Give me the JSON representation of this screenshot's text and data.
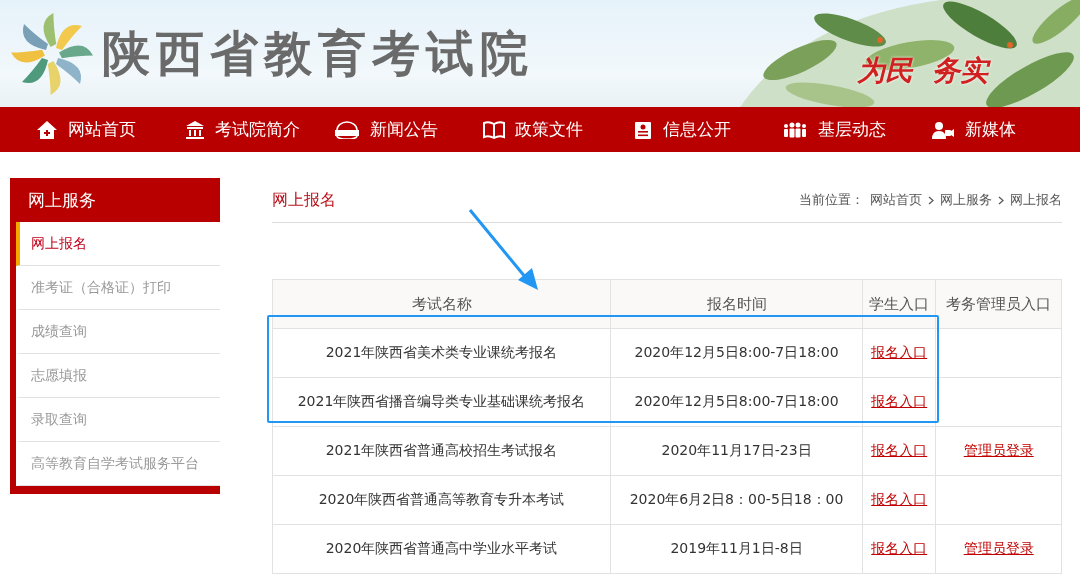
{
  "header": {
    "title": "陕西省教育考试院",
    "slogan": "为民  务实"
  },
  "nav": [
    {
      "label": "网站首页"
    },
    {
      "label": "考试院简介"
    },
    {
      "label": "新闻公告"
    },
    {
      "label": "政策文件"
    },
    {
      "label": "信息公开"
    },
    {
      "label": "基层动态"
    },
    {
      "label": "新媒体"
    }
  ],
  "sidebar": {
    "title": "网上服务",
    "items": [
      {
        "label": "网上报名",
        "selected": true
      },
      {
        "label": "准考证（合格证）打印",
        "selected": false
      },
      {
        "label": "成绩查询",
        "selected": false
      },
      {
        "label": "志愿填报",
        "selected": false
      },
      {
        "label": "录取查询",
        "selected": false
      },
      {
        "label": "高等教育自学考试服务平台",
        "selected": false
      }
    ]
  },
  "main": {
    "title": "网上报名",
    "breadcrumb": {
      "label": "当前位置：",
      "items": [
        "网站首页",
        "网上服务",
        "网上报名"
      ]
    }
  },
  "table": {
    "columns": [
      "考试名称",
      "报名时间",
      "学生入口",
      "考务管理员入口"
    ],
    "rows": [
      {
        "name": "2021年陕西省美术类专业课统考报名",
        "time": "2020年12月5日8:00-7日18:00",
        "student_link": "报名入口",
        "highlighted": true
      },
      {
        "name": "2021年陕西省播音编导类专业基础课统考报名",
        "time": "2020年12月5日8:00-7日18:00",
        "student_link": "报名入口",
        "highlighted": true
      },
      {
        "name": "2021年陕西省普通高校招生考试报名",
        "time": "2020年11月17日-23日",
        "student_link": "报名入口",
        "admin_link": "管理员登录",
        "highlighted": false
      },
      {
        "name": "2020年陕西省普通高等教育专升本考试",
        "time": "2020年6月2日8：00-5日18：00",
        "student_link": "报名入口",
        "highlighted": false
      },
      {
        "name": "2020年陕西省普通高中学业水平考试",
        "time": "2019年11月1日-8日",
        "student_link": "报名入口",
        "admin_link": "管理员登录",
        "highlighted": false
      }
    ]
  }
}
